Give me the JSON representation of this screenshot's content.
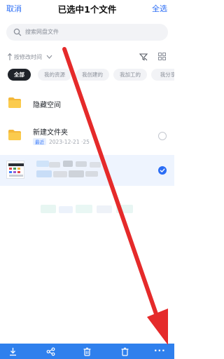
{
  "header": {
    "cancel_label": "取消",
    "title": "已选中1个文件",
    "select_all_label": "全选"
  },
  "search": {
    "placeholder": "搜索网盘文件"
  },
  "sort": {
    "label": "按修改时间"
  },
  "filter_chips": [
    {
      "label": "全部",
      "active": true
    },
    {
      "label": "我的资源",
      "active": false
    },
    {
      "label": "我创建的",
      "active": false
    },
    {
      "label": "我加工的",
      "active": false
    },
    {
      "label": "我分享",
      "active": false
    }
  ],
  "files": [
    {
      "name": "隐藏空间",
      "subtitle": "",
      "selected": false,
      "icon": "folder-icon"
    },
    {
      "name": "新建文件夹",
      "badge": "最近",
      "subtitle": "2023-12-21 ·25",
      "selected": false,
      "icon": "folder-icon"
    },
    {
      "name": "",
      "subtitle": "",
      "selected": true,
      "icon": "image-thumbnail"
    }
  ],
  "toolbar": {
    "icons": [
      "download-icon",
      "share-icon",
      "delete-icon",
      "trash-icon",
      "more-icon"
    ],
    "more_label": "..."
  },
  "colors": {
    "accent": "#2b6df5",
    "toolbar_bg": "#2f80ed",
    "selected_row_bg": "#eef4fe",
    "annotation_arrow": "#e52a2a"
  }
}
